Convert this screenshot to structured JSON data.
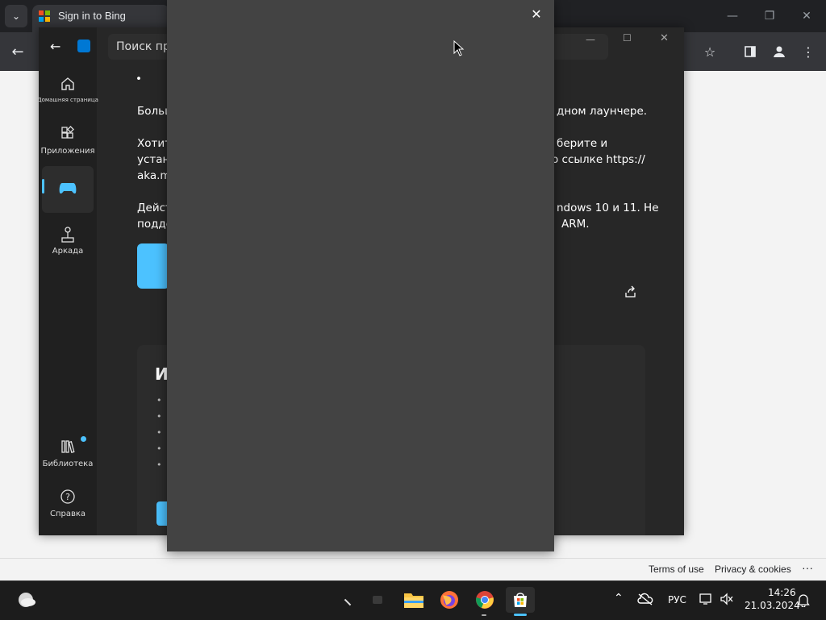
{
  "browser": {
    "tab_title": "Sign in to Bing",
    "dropdown_icon": "chevron-down-icon",
    "window_minimize": "—",
    "window_restore": "❐",
    "window_close": "✕"
  },
  "bing_footer": {
    "terms": "Terms of use",
    "privacy": "Privacy & cookies",
    "more": "···"
  },
  "store": {
    "search_placeholder": "Поиск при",
    "nav": {
      "home": "Домашняя страница",
      "apps": "Приложения",
      "arcade": "Аркада",
      "library": "Библиотека",
      "help": "Справка"
    },
    "content": {
      "bullet": "•",
      "line1_left": "Больш",
      "line1_right": "дном лаунчере.",
      "line2_left": "Хотит",
      "line2_right": "берите и",
      "line3_left": "устано",
      "line3_right": "о ссылке https://",
      "line4_left": "aka.m",
      "line5_left": "Дейст",
      "line5_right": "ndows 10 и 11. Не",
      "line6_left": "подде",
      "line6_right": "ARM.",
      "card_heading": "И"
    }
  },
  "dialog": {
    "close_icon": "✕"
  },
  "taskbar": {
    "language": "РУС",
    "time": "14:26",
    "date": "21.03.2024"
  },
  "colors": {
    "accent": "#4cc2ff",
    "dialog_bg": "#434343",
    "store_bg": "#272727"
  }
}
